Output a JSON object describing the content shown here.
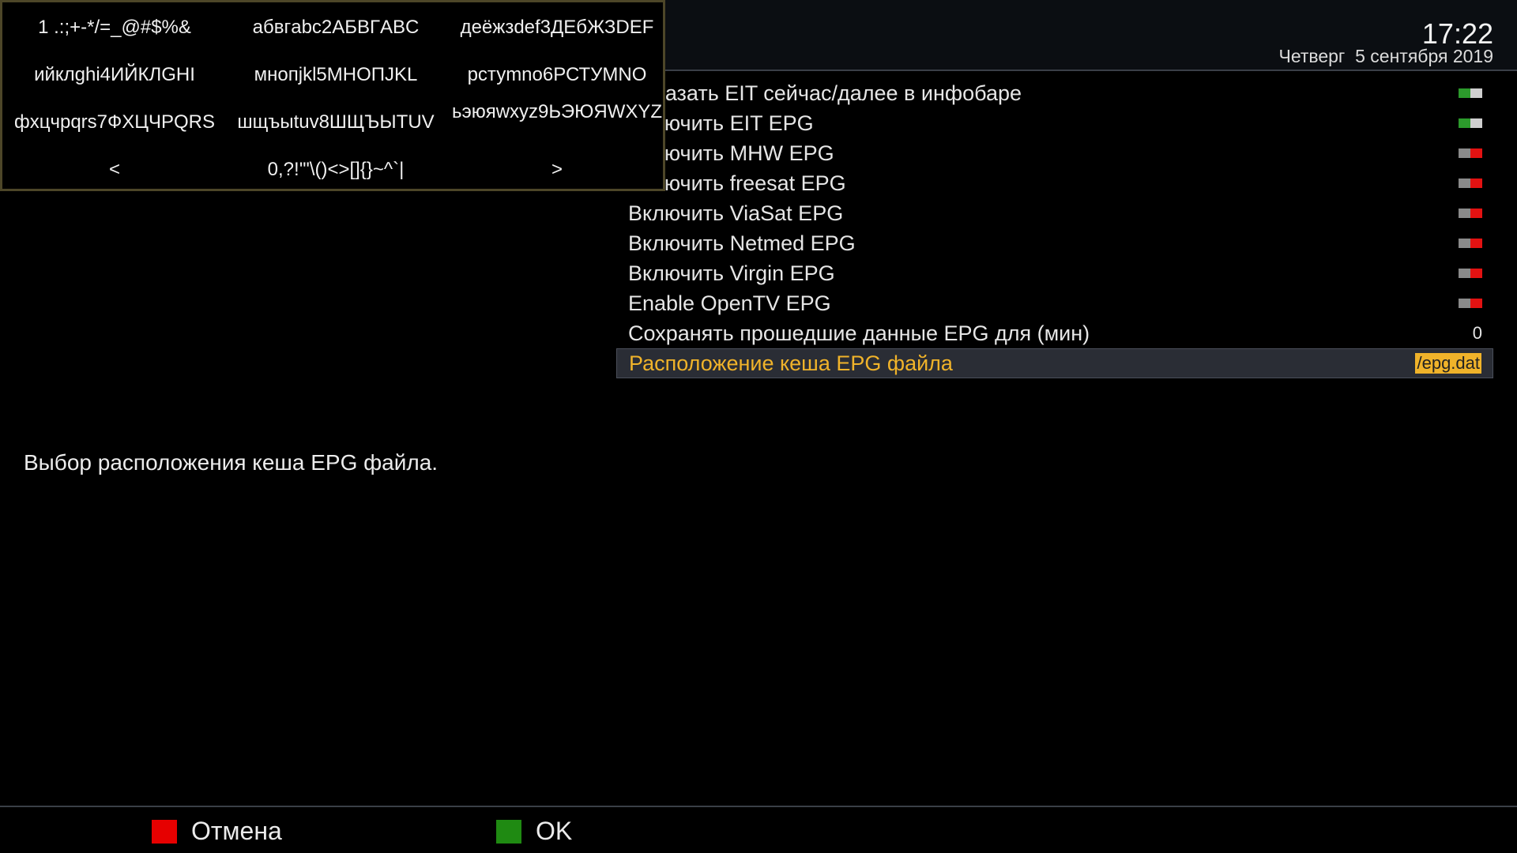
{
  "header": {
    "time": "17:22",
    "date": "Четверг  5 сентября 2019"
  },
  "keyboard": {
    "rows": [
      [
        "1 .:;+-*/=_@#$%&",
        "абвгabc2АБВГABC",
        "деёжзdef3ДЕбЖЗDEF"
      ],
      [
        "ийклghi4ИЙКЛGHI",
        "мнопjkl5МНОПJKL",
        "рстуmno6РСТУMNO"
      ],
      [
        "фхцчpqrs7ФХЦЧPQRS",
        "шщъыtuv8ШЩЪЫTUV",
        "ьэюяwxyz9ЬЭЮЯWXYZ"
      ],
      [
        "<",
        "0,?!'\"\\()<>[]{}~^`|",
        ">"
      ]
    ]
  },
  "settings": {
    "items": [
      {
        "label": "Показать EIT сейчас/далее в инфобаре",
        "state": "on"
      },
      {
        "label": "Включить EIT EPG",
        "state": "on"
      },
      {
        "label": "Включить MHW EPG",
        "state": "off"
      },
      {
        "label": "Включить freesat EPG",
        "state": "off"
      },
      {
        "label": "Включить ViaSat EPG",
        "state": "off"
      },
      {
        "label": "Включить Netmed EPG",
        "state": "off"
      },
      {
        "label": "Включить Virgin EPG",
        "state": "off"
      },
      {
        "label": "Enable OpenTV EPG",
        "state": "off"
      },
      {
        "label": "Сохранять прошедшие данные EPG для (мин)",
        "value": "0"
      },
      {
        "label": "Расположение кеша EPG файла",
        "value": "/epg.dat",
        "selected": true
      }
    ]
  },
  "help_text": "Выбор расположения кеша EPG файла.",
  "footer": {
    "cancel_label": "Отмена",
    "ok_label": "OK"
  },
  "colors": {
    "accent": "#f0b32a",
    "red_key": "#e60000",
    "green_key": "#1f8a12",
    "toggle_on": "#2c9a2c",
    "toggle_off": "#e31212"
  }
}
